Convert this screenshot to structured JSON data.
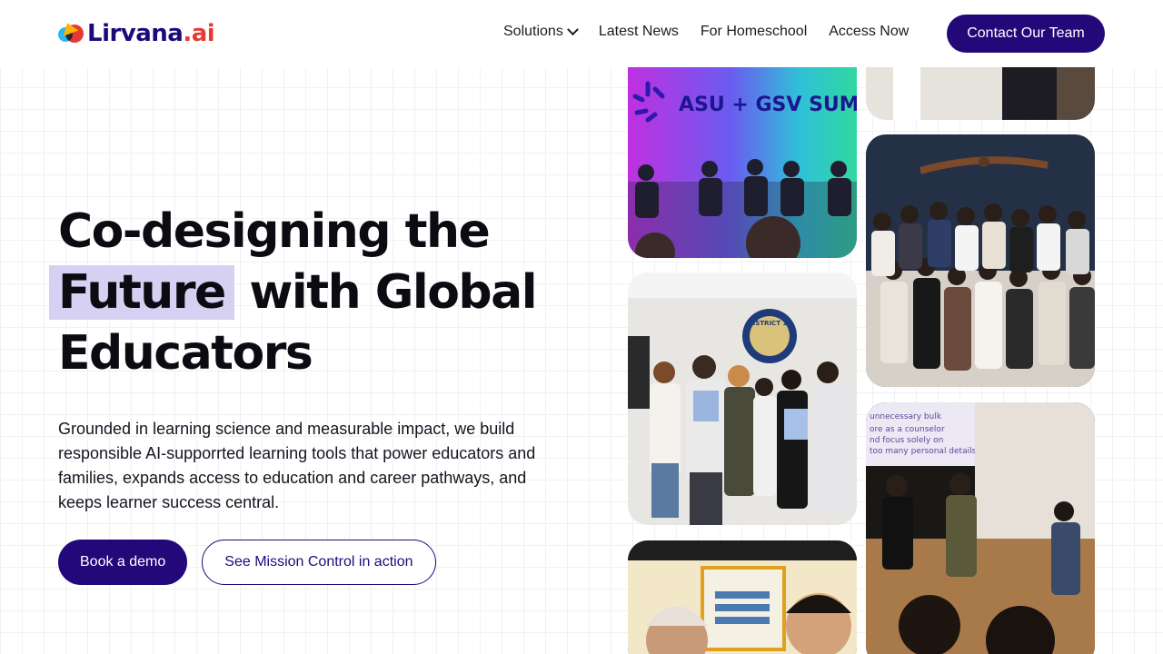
{
  "header": {
    "logo_text": "Lirvana",
    "logo_suffix": ".ai",
    "nav": [
      {
        "label": "Solutions",
        "has_dropdown": true
      },
      {
        "label": "Latest News"
      },
      {
        "label": "For Homeschool"
      },
      {
        "label": "Access Now"
      }
    ],
    "cta_label": "Contact Our Team"
  },
  "hero": {
    "title_line1": "Co-designing the",
    "title_highlight": "Future",
    "title_line2_rest": " with Global",
    "title_line3": "Educators",
    "description": "Grounded in learning science and measurable impact, we build responsible AI-supporrted learning tools that power educators and families, expands access to education and career pathways, and keeps learner success central.",
    "primary_button": "Book a demo",
    "secondary_button": "See Mission Control in action"
  },
  "gallery": {
    "summit_banner_line1": "ASU + GSV SUMMIT",
    "district_seal_text": "DISTRICT 10",
    "slide_lines": [
      "unnecessary bulk",
      "ore as a counselor",
      "nd focus solely on",
      "too many personal details"
    ]
  },
  "colors": {
    "brand": "#23087a",
    "highlight": "#d6d0f2",
    "logo_red": "#e53935"
  }
}
